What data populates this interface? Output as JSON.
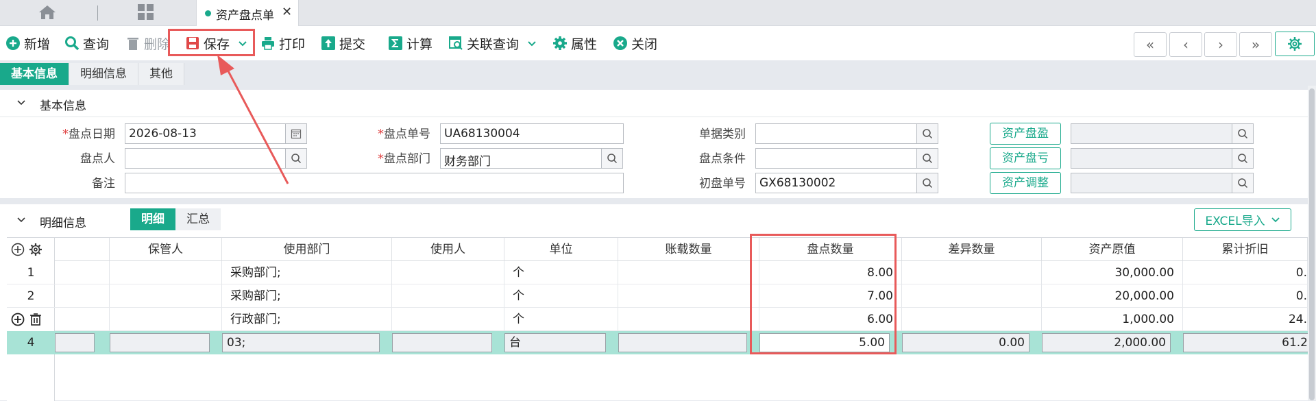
{
  "tabbar": {
    "doc_tab": "资产盘点单"
  },
  "toolbar": {
    "add": "新增",
    "query": "查询",
    "delete": "删除",
    "save": "保存",
    "print": "打印",
    "submit": "提交",
    "calc": "计算",
    "related": "关联查询",
    "props": "属性",
    "close": "关闭"
  },
  "subtabs": [
    "基本信息",
    "明细信息",
    "其他"
  ],
  "basic": {
    "section_title": "基本信息",
    "date_label": "盘点日期",
    "date_value": "2026-08-13",
    "no_label": "盘点单号",
    "no_value": "UA68130004",
    "type_label": "单据类别",
    "type_value": "",
    "person_label": "盘点人",
    "person_value": "",
    "dept_label": "盘点部门",
    "dept_value": "财务部门",
    "cond_label": "盘点条件",
    "cond_value": "",
    "remark_label": "备注",
    "remark_value": "",
    "init_label": "初盘单号",
    "init_value": "GX68130002",
    "btn_surplus": "资产盘盈",
    "btn_loss": "资产盘亏",
    "btn_adjust": "资产调整"
  },
  "detail": {
    "section_title": "明细信息",
    "tabs": [
      "明细",
      "汇总"
    ],
    "excel": "EXCEL导入",
    "columns": [
      "保管人",
      "使用部门",
      "使用人",
      "单位",
      "账载数量",
      "盘点数量",
      "差异数量",
      "资产原值",
      "累计折旧"
    ],
    "rows": [
      {
        "no": "1",
        "dept": "采购部门;",
        "unit": "个",
        "qty": "8.00",
        "orig": "30,000.00",
        "depr": "0."
      },
      {
        "no": "2",
        "dept": "采购部门;",
        "unit": "个",
        "qty": "7.00",
        "orig": "20,000.00",
        "depr": "0."
      },
      {
        "no": "",
        "dept": "行政部门;",
        "unit": "个",
        "qty": "6.00",
        "orig": "1,000.00",
        "depr": "24."
      }
    ],
    "edit_row": {
      "no": "4",
      "dept": "03;",
      "unit": "台",
      "qty": "5.00",
      "diff": "0.00",
      "orig": "2,000.00",
      "depr": "61.2"
    }
  }
}
